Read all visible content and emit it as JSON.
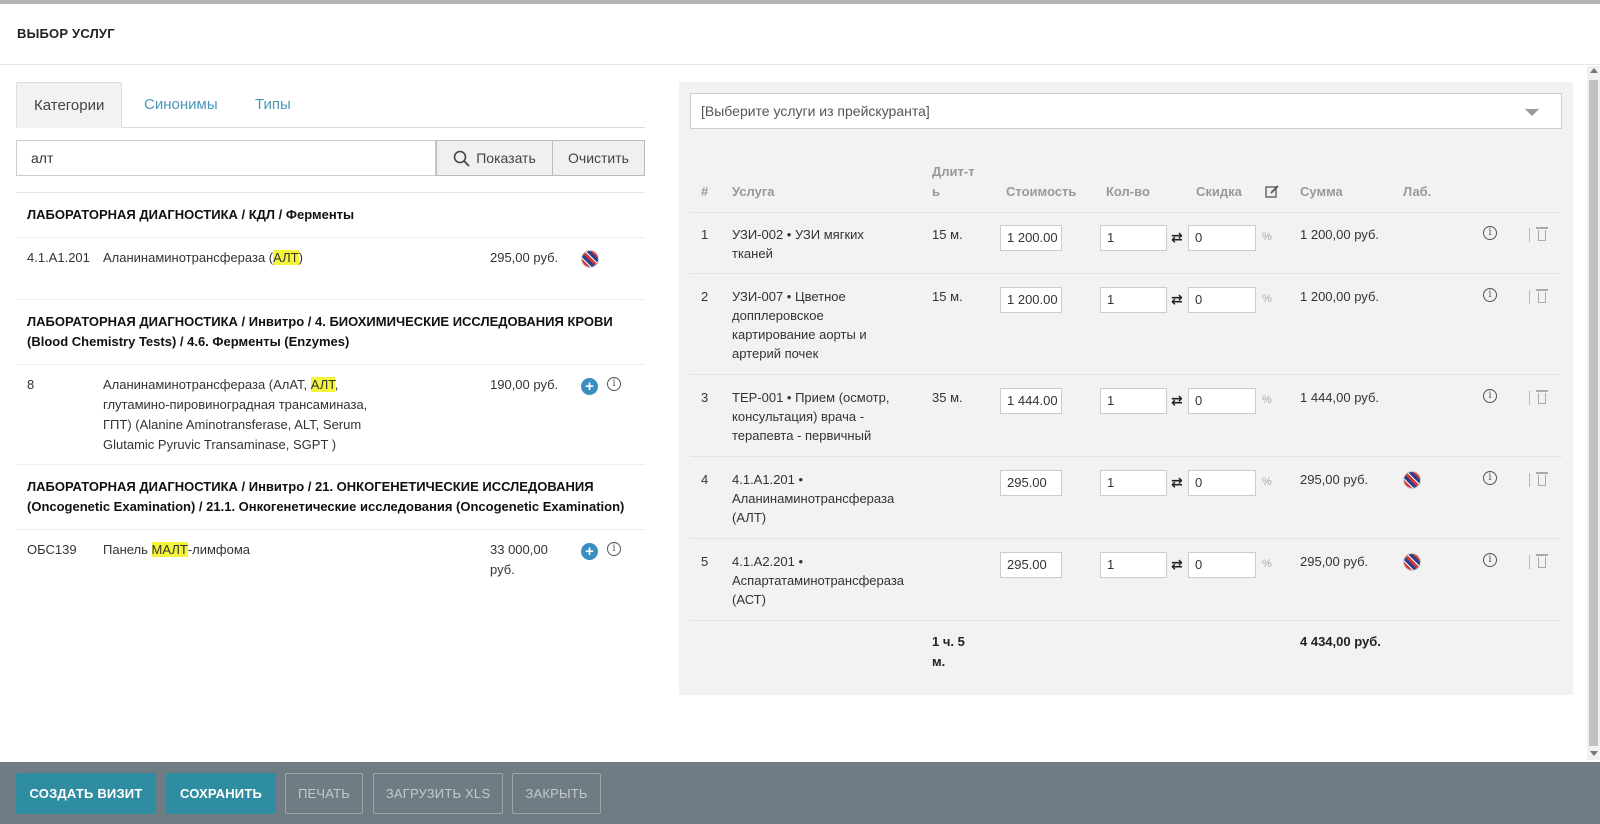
{
  "header": {
    "title": "ВЫБОР УСЛУГ"
  },
  "tabs": [
    {
      "label": "Категории",
      "active": true
    },
    {
      "label": "Синонимы",
      "active": false
    },
    {
      "label": "Типы",
      "active": false
    }
  ],
  "search": {
    "value": "алт",
    "show_label": "Показать",
    "clear_label": "Очистить"
  },
  "results": {
    "cat1": "ЛАБОРАТОРНАЯ ДИАГНОСТИКА / КДЛ / Ферменты",
    "item1": {
      "code": "4.1.А1.201",
      "name_pre": "Аланинаминотрансфераза (",
      "name_hl": "АЛТ",
      "name_post": ")",
      "price": "295,00 руб."
    },
    "cat2": "ЛАБОРАТОРНАЯ ДИАГНОСТИКА / Инвитро / 4. БИОХИМИЧЕСКИЕ ИССЛЕДОВАНИЯ КРОВИ (Blood Chemistry Tests) / 4.6. Ферменты (Enzymes)",
    "item2": {
      "code": "8",
      "name_pre": "Аланинаминотрансфераза (АлАТ, ",
      "name_hl": "АЛТ",
      "name_post": ", глутамино-пировиноградная трансаминаза, ГПТ) (Alanine Aminotransferase, ALT, Serum Glutamic Pyruvic Transaminase, SGPT )",
      "price": "190,00 руб."
    },
    "cat3": "ЛАБОРАТОРНАЯ ДИАГНОСТИКА / Инвитро / 21. ОНКОГЕНЕТИЧЕСКИЕ ИССЛЕДОВАНИЯ (Oncogenetic Examination) / 21.1. Онкогенетические исследования (Oncogenetic Examination)",
    "item3": {
      "code": "ОБС139",
      "name_pre": "Панель ",
      "name_hl": "МАЛТ",
      "name_post": "-лимфома",
      "price": "33 000,00 руб."
    }
  },
  "pricelist": {
    "placeholder": "[Выберите услуги из прейскуранта]",
    "columns": {
      "num": "#",
      "service": "Услуга",
      "duration": "Длит-ть",
      "cost": "Стоимость",
      "qty": "Кол-во",
      "discount": "Скидка",
      "sum": "Сумма",
      "lab": "Лаб."
    },
    "rows": [
      {
        "num": "1",
        "service": "УЗИ-002 • УЗИ мягких тканей",
        "duration": "15 м.",
        "cost": "1 200.00",
        "qty": "1",
        "discount": "0",
        "pct": "%",
        "sum": "1 200,00 руб.",
        "lab": false
      },
      {
        "num": "2",
        "service": "УЗИ-007 • Цветное допплеровское картирование аорты и артерий почек",
        "duration": "15 м.",
        "cost": "1 200.00",
        "qty": "1",
        "discount": "0",
        "pct": "%",
        "sum": "1 200,00 руб.",
        "lab": false
      },
      {
        "num": "3",
        "service": "ТЕР-001 • Прием (осмотр, консультация) врача - терапевта - первичный",
        "duration": "35 м.",
        "cost": "1 444.00",
        "qty": "1",
        "discount": "0",
        "pct": "%",
        "sum": "1 444,00 руб.",
        "lab": false
      },
      {
        "num": "4",
        "service": "4.1.А1.201 • Аланинаминотрансфераза (АЛТ)",
        "duration": "",
        "cost": "295.00",
        "qty": "1",
        "discount": "0",
        "pct": "%",
        "sum": "295,00 руб.",
        "lab": true
      },
      {
        "num": "5",
        "service": "4.1.А2.201 • Аспартатаминотрансфераза (АСТ)",
        "duration": "",
        "cost": "295.00",
        "qty": "1",
        "discount": "0",
        "pct": "%",
        "sum": "295,00 руб.",
        "lab": true
      }
    ],
    "total_duration": "1 ч. 5 м.",
    "total_sum": "4 434,00 руб."
  },
  "icons": {
    "swap": "⇄",
    "info": "i"
  },
  "footer": {
    "create_visit": "СОЗДАТЬ ВИЗИТ",
    "save": "СОХРАНИТЬ",
    "print": "ПЕЧАТЬ",
    "upload_xls": "ЗАГРУЗИТЬ XLS",
    "close": "ЗАКРЫТЬ"
  },
  "colors": {
    "primary": "#2f8da1",
    "footer_bg": "#6f7c83",
    "tab_link": "#4a98b8",
    "highlight": "#f4f43a",
    "plus": "#3a8fc0"
  }
}
